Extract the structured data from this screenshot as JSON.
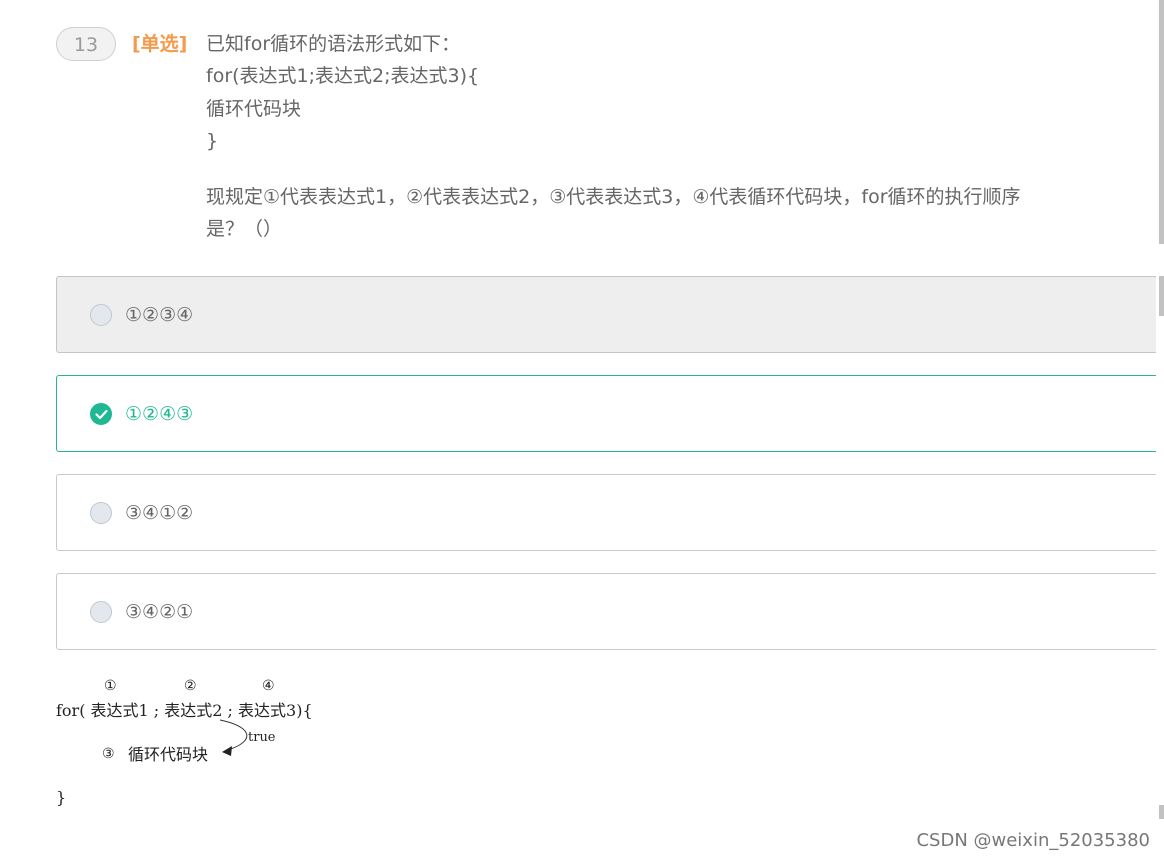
{
  "question": {
    "number": "13",
    "type_label": "[单选]",
    "stem_lines": [
      "已知for循环的语法形式如下：",
      " for(表达式1;表达式2;表达式3){",
      "    循环代码块",
      " }"
    ],
    "prompt_lines": [
      "现规定①代表表达式1，②代表表达式2，③代表表达式3，④代表循环代码块，for循环的执行顺序",
      "是？（）"
    ]
  },
  "options": [
    {
      "label": "①②③④",
      "state": "hover",
      "selected": false
    },
    {
      "label": "①②④③",
      "state": "selected",
      "selected": true
    },
    {
      "label": "③④①②",
      "state": "normal",
      "selected": false
    },
    {
      "label": "③④②①",
      "state": "normal",
      "selected": false
    }
  ],
  "diagram": {
    "markers": [
      "①",
      "②",
      "④"
    ],
    "for_line": "for( 表达式1 ; 表达式2 ; 表达式3){",
    "true_label": "true",
    "body_marker": "③",
    "body_text": "循环代码块",
    "closing_brace": "}"
  },
  "watermark": "CSDN @weixin_52035380",
  "colors": {
    "accent_green": "#1fb893",
    "type_orange": "#f39a4c",
    "text_gray": "#666666"
  }
}
